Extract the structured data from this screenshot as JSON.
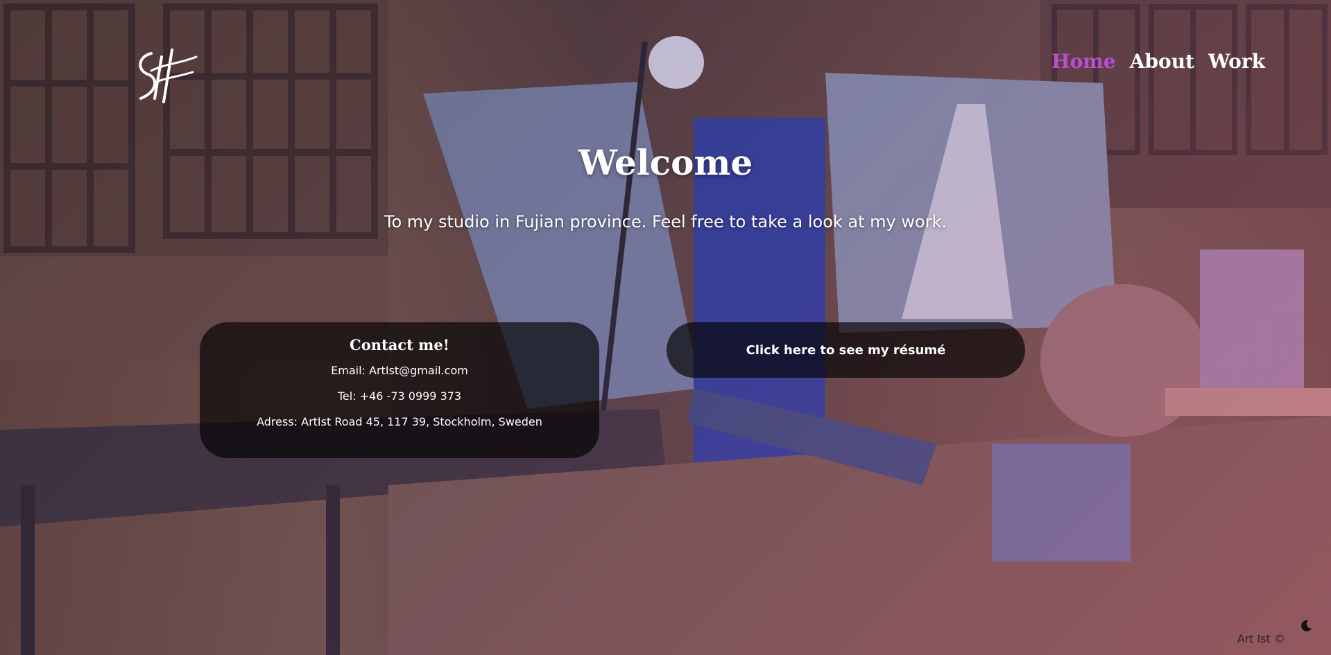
{
  "nav": {
    "items": [
      {
        "label": "Home",
        "active": true
      },
      {
        "label": "About",
        "active": false
      },
      {
        "label": "Work",
        "active": false
      }
    ],
    "active_color": "#b84fcf"
  },
  "hero": {
    "title": "Welcome",
    "subtitle": "To my studio in Fujian province. Feel free to take a look at my work."
  },
  "contact": {
    "heading": "Contact me!",
    "email": "Email: ArtIst@gmail.com",
    "tel": "Tel: +46 -73 0999 373",
    "address": "Adress: ArtIst Road 45, 117 39, Stockholm, Sweden"
  },
  "resume": {
    "label": "Click here to see my résumé"
  },
  "footer": {
    "copyright": "Art Ist ©",
    "theme_icon": "moon-icon"
  },
  "logo": {
    "icon": "signature-logo"
  }
}
